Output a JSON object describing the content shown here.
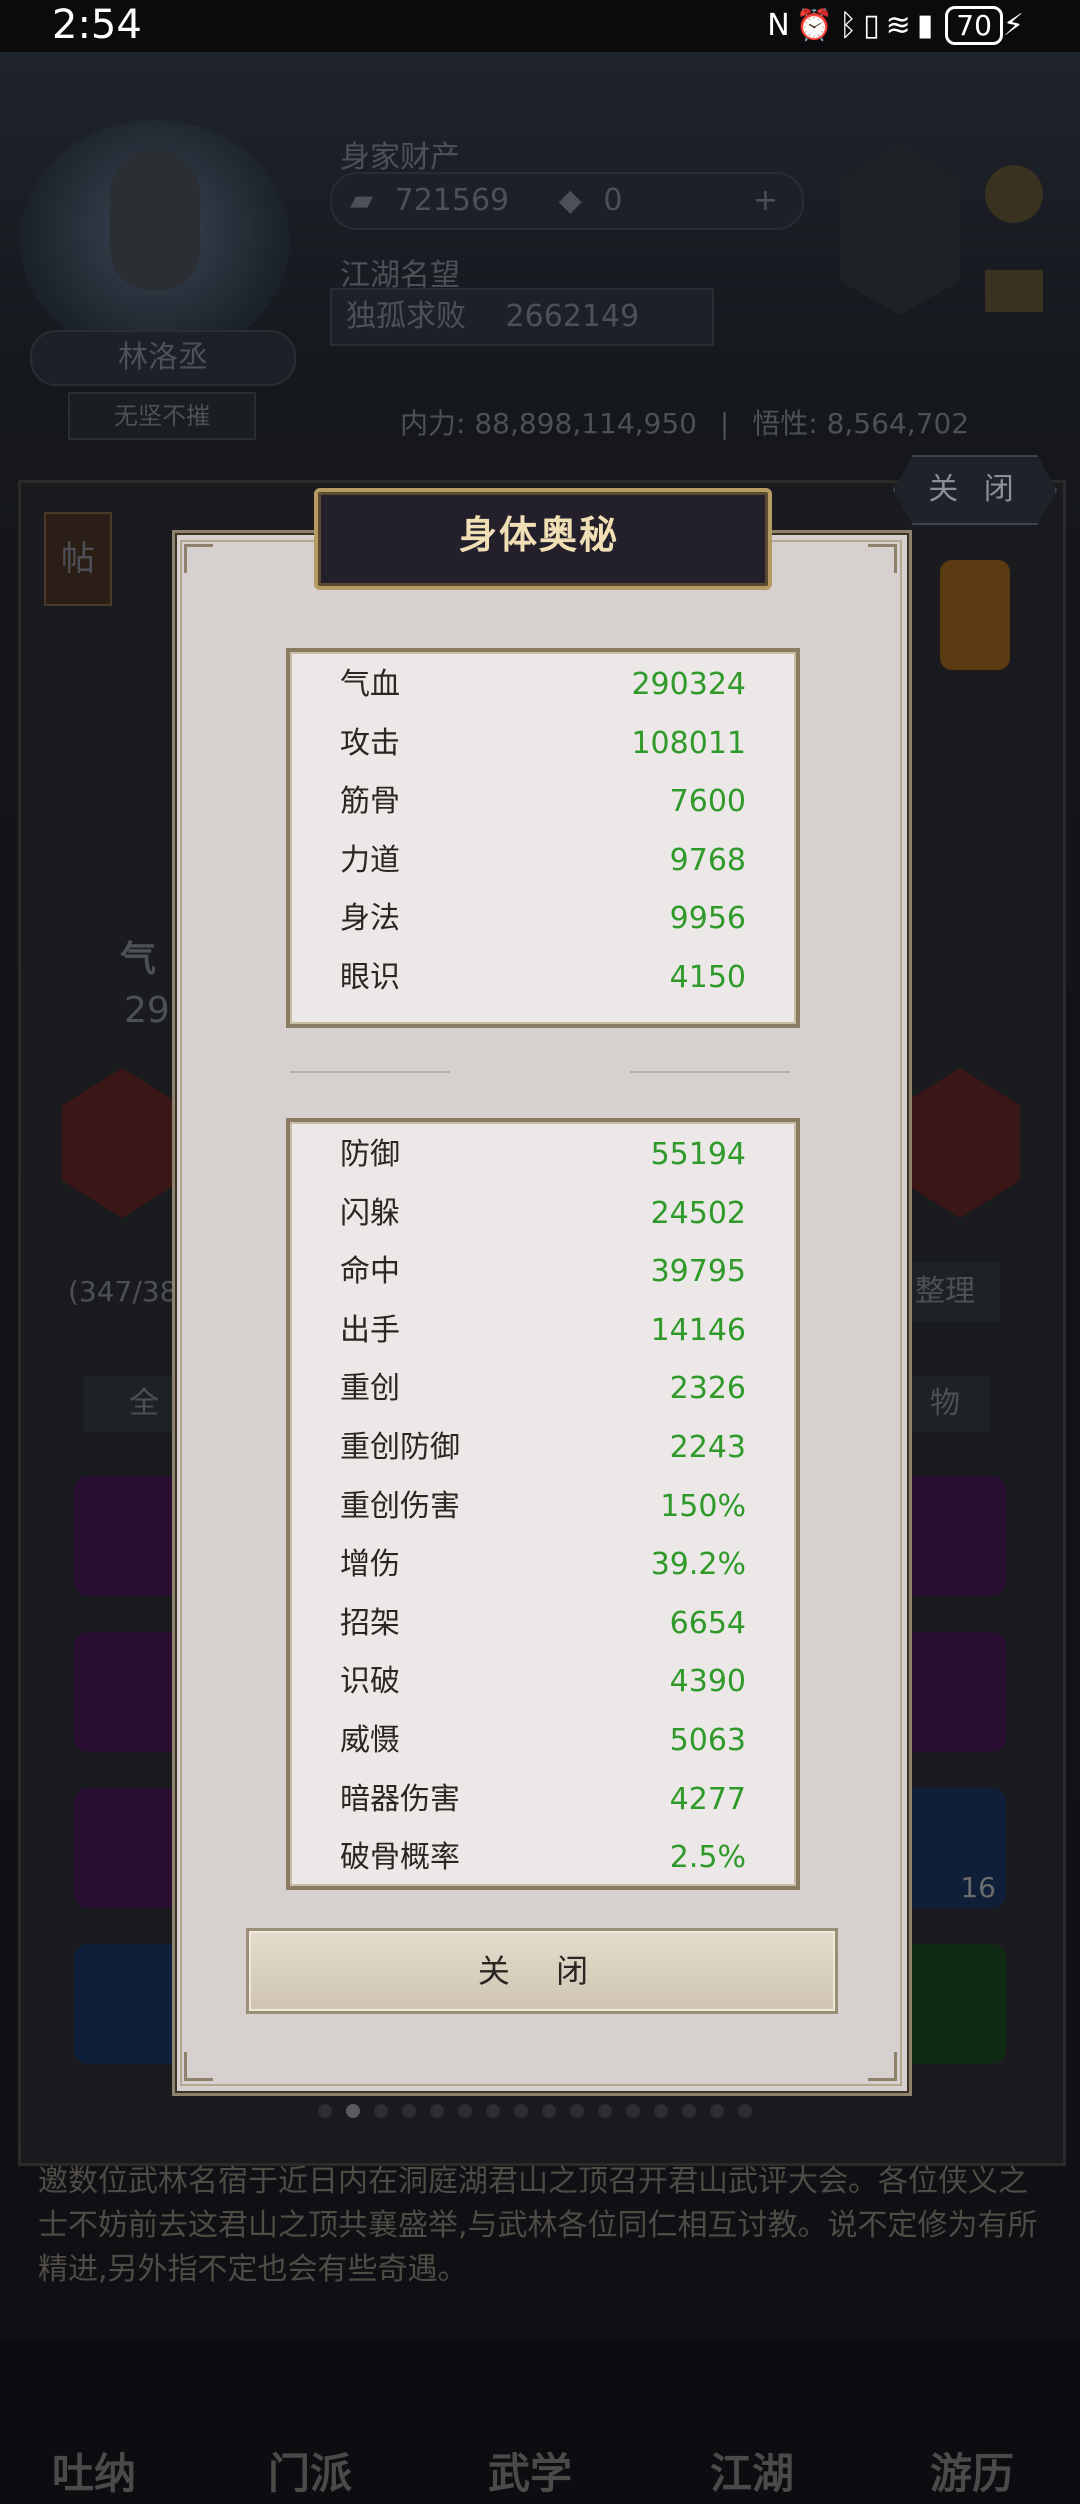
{
  "status_bar": {
    "time": "2:54",
    "battery": "70"
  },
  "header": {
    "player_name": "林洛丞",
    "player_title": "无坚不摧",
    "wealth_label": "身家财产",
    "gold": "721569",
    "jade": "0",
    "plus": "+",
    "fame_label": "江湖名望",
    "fame_title": "独孤求败",
    "fame_value": "2662149",
    "inner_power": "内力: 88,898,114,950",
    "pet_stat": "悟性: 8,564,702"
  },
  "background_panel": {
    "close_label": "关 闭",
    "tie_label": "帖",
    "inventory_count": "(347/38",
    "organize_label": "整理",
    "filter_all": "全",
    "filter_items": "物",
    "slot_badge": "16",
    "qi_label": "气",
    "qi_value": "29"
  },
  "notice_text": "邀数位武林名宿于近日内在洞庭湖君山之顶召开君山武评大会。各位侠义之士不妨前去这君山之顶共襄盛举,与武林各位同仁相互讨教。说不定修为有所精进,另外指不定也会有些奇遇。",
  "bottom_nav": [
    "吐纳",
    "门派",
    "武学",
    "江湖",
    "游历"
  ],
  "dialog": {
    "title": "身体奥秘",
    "basic_stats": [
      {
        "label": "气血",
        "value": "290324"
      },
      {
        "label": "攻击",
        "value": "108011"
      },
      {
        "label": "筋骨",
        "value": "7600"
      },
      {
        "label": "力道",
        "value": "9768"
      },
      {
        "label": "身法",
        "value": "9956"
      },
      {
        "label": "眼识",
        "value": "4150"
      }
    ],
    "advanced_stats": [
      {
        "label": "防御",
        "value": "55194"
      },
      {
        "label": "闪躲",
        "value": "24502"
      },
      {
        "label": "命中",
        "value": "39795"
      },
      {
        "label": "出手",
        "value": "14146"
      },
      {
        "label": "重创",
        "value": "2326"
      },
      {
        "label": "重创防御",
        "value": "2243"
      },
      {
        "label": "重创伤害",
        "value": "150%"
      },
      {
        "label": "增伤",
        "value": "39.2%"
      },
      {
        "label": "招架",
        "value": "6654"
      },
      {
        "label": "识破",
        "value": "4390"
      },
      {
        "label": "威慑",
        "value": "5063"
      },
      {
        "label": "暗器伤害",
        "value": "4277"
      },
      {
        "label": "破骨概率",
        "value": "2.5%"
      }
    ],
    "close_label": "关 闭"
  },
  "colors": {
    "stat_value": "#2f9a2a",
    "title_text": "#f0deb4",
    "dialog_bg": "#d6d0cf",
    "frame": "#8a7b63"
  }
}
